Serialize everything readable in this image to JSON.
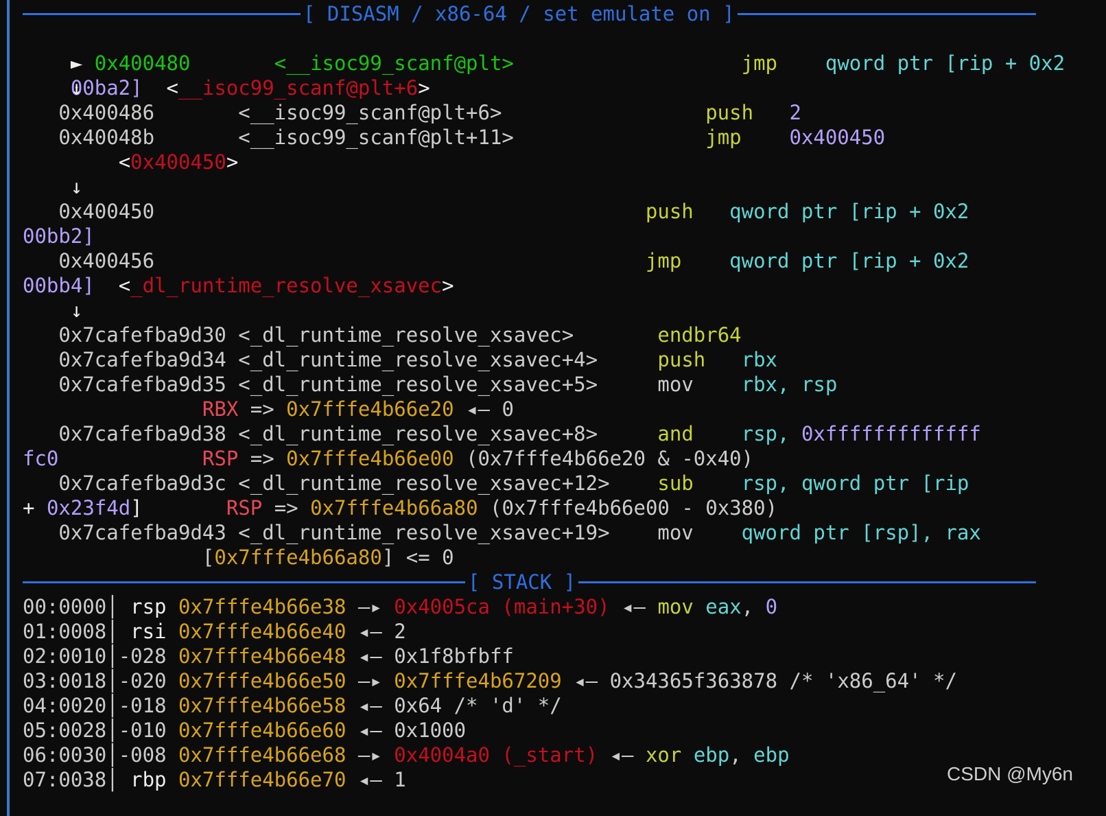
{
  "disasm_header": "[ DISASM / x86-64 / set emulate on ]",
  "stack_header": "[ STACK ]",
  "watermark": "CSDN @My6n",
  "disasm": {
    "l01": {
      "marker": "►",
      "addr": "0x400480",
      "sym": "<__isoc99_scanf@plt>",
      "op": "jmp",
      "operands": "qword ptr [rip + 0x2"
    },
    "l02": {
      "cont": "00ba2]",
      "sym_open": "<",
      "sym": "__isoc99_scanf@plt+6",
      "sym_close": ">"
    },
    "l03": {
      "arrow": "↓"
    },
    "l04": {
      "addr": "0x400486",
      "sym": "<__isoc99_scanf@plt+6>",
      "op": "push",
      "operands": "2"
    },
    "l05": {
      "addr": "0x40048b",
      "sym": "<__isoc99_scanf@plt+11>",
      "op": "jmp",
      "operands": "0x400450"
    },
    "l06": {
      "sym_open": "<",
      "sym": "0x400450",
      "sym_close": ">"
    },
    "l07": {
      "arrow": "↓"
    },
    "l08": {
      "addr": "0x400450",
      "op": "push",
      "operands": "qword ptr [rip + 0x2"
    },
    "l09": {
      "cont": "00bb2]"
    },
    "l10": {
      "addr": "0x400456",
      "op": "jmp",
      "operands": "qword ptr [rip + 0x2"
    },
    "l11": {
      "cont": "00bb4]",
      "sym_open": "<",
      "sym": "_dl_runtime_resolve_xsavec",
      "sym_close": ">"
    },
    "l12": {
      "arrow": "↓"
    },
    "l13": {
      "addr": "0x7cafefba9d30",
      "sym": "<_dl_runtime_resolve_xsavec>",
      "op": "endbr64"
    },
    "l14": {
      "addr": "0x7cafefba9d34",
      "sym": "<_dl_runtime_resolve_xsavec+4>",
      "op": "push",
      "operands": "rbx"
    },
    "l15": {
      "addr": "0x7cafefba9d35",
      "sym": "<_dl_runtime_resolve_xsavec+5>",
      "op": "mov",
      "operands": "rbx, rsp"
    },
    "l16": {
      "reg": "RBX",
      "arrow": "=>",
      "val": "0x7fffe4b66e20",
      "rest": "◂— 0"
    },
    "l17": {
      "addr": "0x7cafefba9d38",
      "sym": "<_dl_runtime_resolve_xsavec+8>",
      "op": "and",
      "reg": "rsp,",
      "operands": "0xfffffffffffff"
    },
    "l18": {
      "cont": "fc0",
      "reg": "RSP",
      "arrow": "=>",
      "val": "0x7fffe4b66e00",
      "rest": "(0x7fffe4b66e20 & -0x40)"
    },
    "l19": {
      "addr": "0x7cafefba9d3c",
      "sym": "<_dl_runtime_resolve_xsavec+12>",
      "op": "sub",
      "reg": "rsp,",
      "operands": "qword ptr [rip"
    },
    "l20": {
      "cont_plus": "+",
      "cont": "0x23f4d",
      "cont_close": "]",
      "reg": "RSP",
      "arrow": "=>",
      "val": "0x7fffe4b66a80",
      "rest": "(0x7fffe4b66e00 - 0x380)"
    },
    "l21": {
      "addr": "0x7cafefba9d43",
      "sym": "<_dl_runtime_resolve_xsavec+19>",
      "op": "mov",
      "operands": "qword ptr [rsp], rax"
    },
    "l22": {
      "open": "[",
      "val": "0x7fffe4b66a80",
      "rest": "] <= 0"
    }
  },
  "stack": [
    {
      "idx": "00:0000",
      "off": "rsp",
      "addr": "0x7fffe4b66e38",
      "link": "—▸",
      "target": "0x4005ca (main+30)",
      "rest_arrow": "◂—",
      "instr": "mov",
      "instr_args_a": "eax",
      "instr_sep": ",",
      "instr_args_b": "0"
    },
    {
      "idx": "01:0008",
      "off": "rsi",
      "addr": "0x7fffe4b66e40",
      "link": "◂—",
      "value": "2"
    },
    {
      "idx": "02:0010",
      "off": "-028",
      "addr": "0x7fffe4b66e48",
      "link": "◂—",
      "value": "0x1f8bfbff"
    },
    {
      "idx": "03:0018",
      "off": "-020",
      "addr": "0x7fffe4b66e50",
      "link": "—▸",
      "target": "0x7fffe4b67209",
      "rest_arrow": "◂—",
      "value": "0x34365f363878 /* 'x86_64' */"
    },
    {
      "idx": "04:0020",
      "off": "-018",
      "addr": "0x7fffe4b66e58",
      "link": "◂—",
      "value": "0x64 /* 'd' */"
    },
    {
      "idx": "05:0028",
      "off": "-010",
      "addr": "0x7fffe4b66e60",
      "link": "◂—",
      "value": "0x1000"
    },
    {
      "idx": "06:0030",
      "off": "-008",
      "addr": "0x7fffe4b66e68",
      "link": "—▸",
      "target": "0x4004a0 (_start)",
      "rest_arrow": "◂—",
      "instr": "xor",
      "instr_args_a": "ebp",
      "instr_sep": ",",
      "instr_args_b": "ebp"
    },
    {
      "idx": "07:0038",
      "off": "rbp",
      "addr": "0x7fffe4b66e70",
      "link": "◂—",
      "value": "1"
    }
  ],
  "colors": {
    "background": "#0c0c0c",
    "rule": "#2f6fe0",
    "address": "#d9a416",
    "symbol_red": "#e74856",
    "mnemonic": "#c6d431",
    "register": "#61d6d6",
    "immediate": "#b4a0ff",
    "current": "#16c60c"
  }
}
